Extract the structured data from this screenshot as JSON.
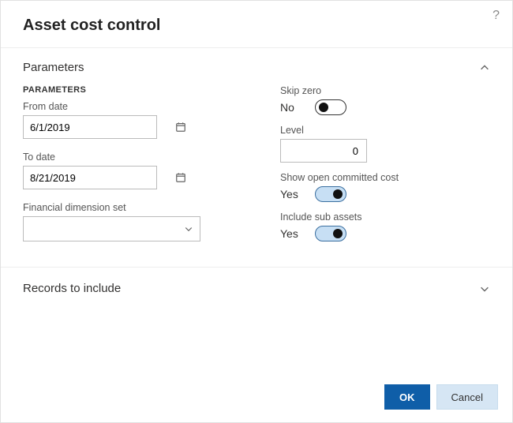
{
  "header": {
    "title": "Asset cost control"
  },
  "sections": {
    "parameters": {
      "title": "Parameters",
      "subhead": "PARAMETERS",
      "fromDateLabel": "From date",
      "fromDateValue": "6/1/2019",
      "toDateLabel": "To date",
      "toDateValue": "8/21/2019",
      "financialDimLabel": "Financial dimension set",
      "financialDimValue": "",
      "skipZeroLabel": "Skip zero",
      "skipZeroValue": "No",
      "levelLabel": "Level",
      "levelValue": "0",
      "showOpenCommittedLabel": "Show open committed cost",
      "showOpenCommittedValue": "Yes",
      "includeSubAssetsLabel": "Include sub assets",
      "includeSubAssetsValue": "Yes"
    },
    "records": {
      "title": "Records to include"
    }
  },
  "buttons": {
    "ok": "OK",
    "cancel": "Cancel"
  }
}
